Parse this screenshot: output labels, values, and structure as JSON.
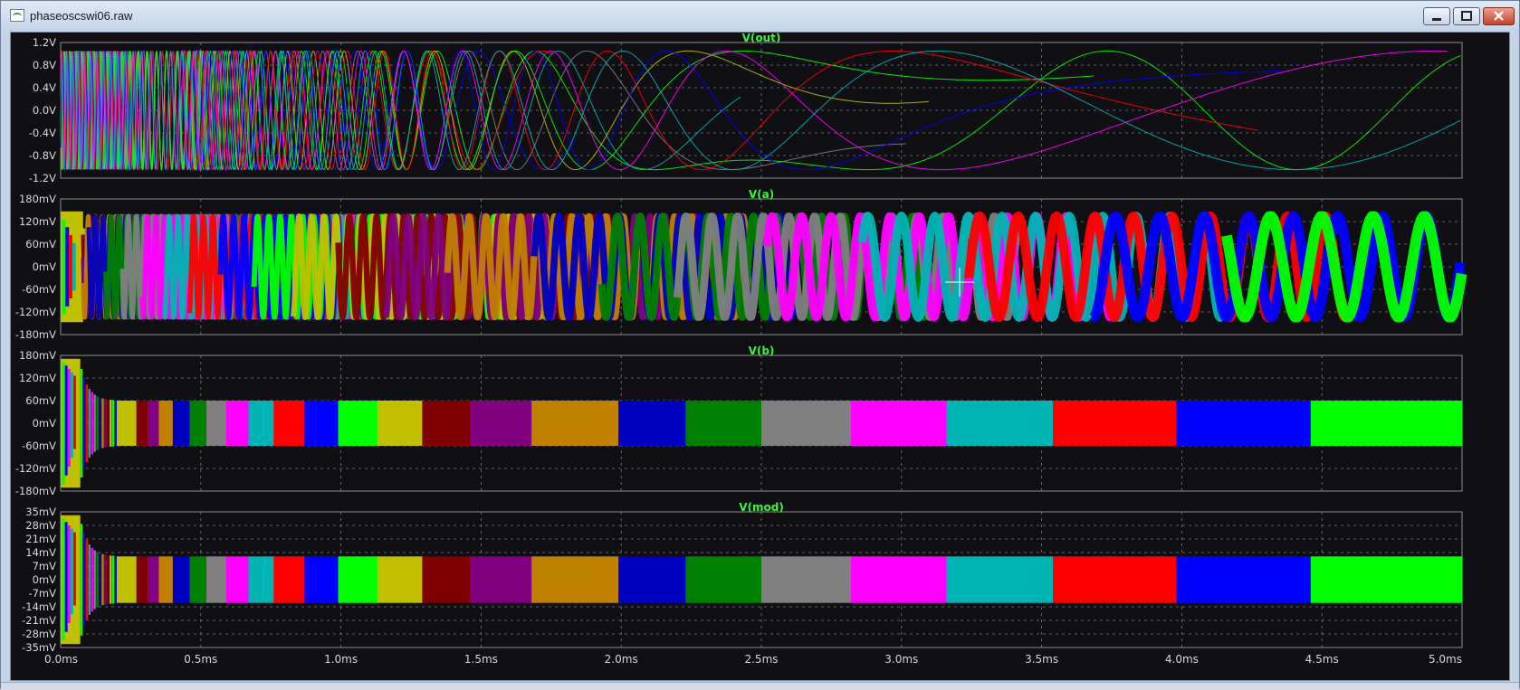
{
  "window": {
    "title": "phaseoscswi06.raw",
    "controls": {
      "minimize": "minimize-icon",
      "maximize": "maximize-icon",
      "close": "close-icon"
    }
  },
  "colors": {
    "background": "#0f0f14",
    "grid": "#7f7f7f",
    "axis_text": "#d9d9d9",
    "title_text": "#39f53a",
    "series_palette": [
      "#00ff00",
      "#0000ff",
      "#ff0000",
      "#00b4b4",
      "#ff00ff",
      "#808080",
      "#008000",
      "#0000c0",
      "#c08000",
      "#800080",
      "#800000",
      "#c0c000"
    ]
  },
  "chart_data": {
    "type": "line",
    "xlabel": "",
    "xlim": [
      0,
      5.0
    ],
    "x_unit": "ms",
    "x_ticks": [
      "0.0ms",
      "0.5ms",
      "1.0ms",
      "1.5ms",
      "2.0ms",
      "2.5ms",
      "3.0ms",
      "3.5ms",
      "4.0ms",
      "4.5ms",
      "5.0ms"
    ],
    "grid": true,
    "panes": [
      {
        "title": "V(out)",
        "unit": "V",
        "ylim": [
          -1.2,
          1.2
        ],
        "y_ticks": [
          "1.2V",
          "0.8V",
          "0.4V",
          "0.0V",
          "-0.4V",
          "-0.8V",
          "-1.2V"
        ],
        "amplitude": 1.05,
        "style": "line"
      },
      {
        "title": "V(a)",
        "unit": "mV",
        "ylim": [
          -180,
          180
        ],
        "y_ticks": [
          "180mV",
          "120mV",
          "60mV",
          "0mV",
          "-60mV",
          "-120mV",
          "-180mV"
        ],
        "amplitude": 140,
        "style": "band"
      },
      {
        "title": "V(b)",
        "unit": "mV",
        "ylim": [
          -180,
          180
        ],
        "y_ticks": [
          "180mV",
          "120mV",
          "60mV",
          "0mV",
          "-60mV",
          "-120mV",
          "-180mV"
        ],
        "amplitude": 60,
        "style": "blocks"
      },
      {
        "title": "V(mod)",
        "unit": "mV",
        "ylim": [
          -35,
          35
        ],
        "y_ticks": [
          "35mV",
          "28mV",
          "21mV",
          "14mV",
          "7mV",
          "0mV",
          "-7mV",
          "-14mV",
          "-21mV",
          "-28mV",
          "-35mV"
        ],
        "amplitude": 12,
        "style": "blocks"
      }
    ],
    "step_segments_ms": [
      [
        0.2,
        0.27,
        "#c0c000"
      ],
      [
        0.27,
        0.31,
        "#800000"
      ],
      [
        0.31,
        0.35,
        "#800080"
      ],
      [
        0.35,
        0.4,
        "#c08000"
      ],
      [
        0.4,
        0.46,
        "#0000c0"
      ],
      [
        0.46,
        0.52,
        "#008000"
      ],
      [
        0.52,
        0.59,
        "#808080"
      ],
      [
        0.59,
        0.67,
        "#ff00ff"
      ],
      [
        0.67,
        0.76,
        "#00b4b4"
      ],
      [
        0.76,
        0.87,
        "#ff0000"
      ],
      [
        0.87,
        0.99,
        "#0000ff"
      ],
      [
        0.99,
        1.13,
        "#00ff00"
      ],
      [
        1.13,
        1.29,
        "#c0c000"
      ],
      [
        1.29,
        1.46,
        "#800000"
      ],
      [
        1.46,
        1.68,
        "#800080"
      ],
      [
        1.68,
        1.99,
        "#c08000"
      ],
      [
        1.99,
        2.23,
        "#0000c0"
      ],
      [
        2.23,
        2.5,
        "#008000"
      ],
      [
        2.5,
        2.82,
        "#808080"
      ],
      [
        2.82,
        3.16,
        "#ff00ff"
      ],
      [
        3.16,
        3.54,
        "#00b4b4"
      ],
      [
        3.54,
        3.98,
        "#ff0000"
      ],
      [
        3.98,
        4.46,
        "#0000ff"
      ],
      [
        4.46,
        5.0,
        "#00ff00"
      ]
    ]
  }
}
